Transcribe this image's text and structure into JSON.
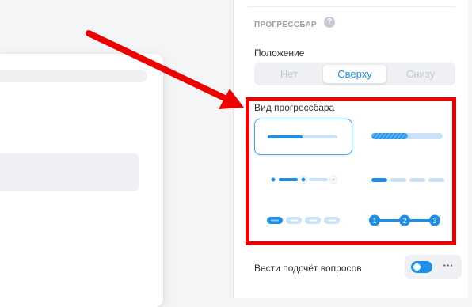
{
  "canvas": {
    "preview_label": ""
  },
  "panel": {
    "section_title": "ПРОГРЕССБАР",
    "help_icon": "?",
    "position_label": "Положение",
    "position_options": [
      "Нет",
      "Сверху",
      "Снизу"
    ],
    "position_selected": "Сверху",
    "style_label": "Вид прогрессбара",
    "style_options": [
      {
        "name": "line",
        "selected": true
      },
      {
        "name": "striped-line",
        "selected": false
      },
      {
        "name": "dots-segments",
        "selected": false
      },
      {
        "name": "segments",
        "selected": false
      },
      {
        "name": "pills",
        "selected": false
      },
      {
        "name": "numbered-steps",
        "selected": false
      }
    ],
    "numbered_steps": [
      "1",
      "2",
      "3"
    ],
    "counter_label": "Вести подсчёт вопросов",
    "counter_enabled": true,
    "more_label": "···"
  },
  "colors": {
    "accent": "#1e8fe8",
    "accent_light": "#c9e2f8",
    "annotation_red": "#ee0000"
  }
}
